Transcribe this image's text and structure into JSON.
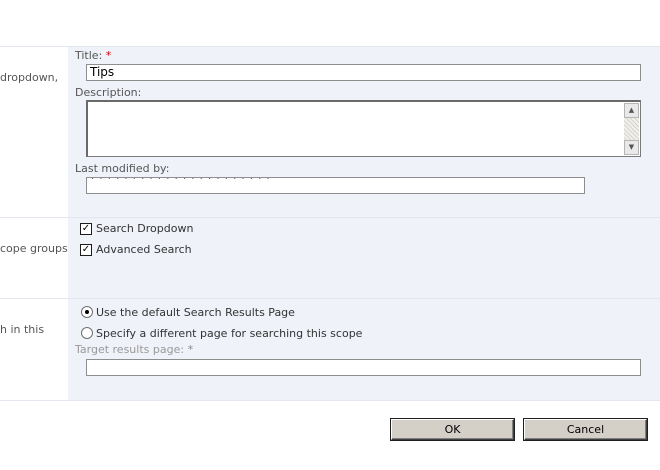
{
  "section_name": {
    "left_label": "dropdown,",
    "title_label": "Title:",
    "required_marker": "*",
    "title_value": "Tips",
    "description_label": "Description:",
    "description_value": "",
    "last_modified_label": "Last modified by:",
    "last_modified_value": "· · · · · · · · · · · · · · · · · · · · · ·"
  },
  "section_groups": {
    "left_label": "cope groups",
    "options": [
      {
        "label": "Search Dropdown",
        "checked": true
      },
      {
        "label": "Advanced Search",
        "checked": true
      }
    ]
  },
  "section_results": {
    "left_label": "h in this",
    "radio_default_label": "Use the default Search Results Page",
    "radio_specify_label": "Specify a different page for searching this scope",
    "target_label": "Target results page:",
    "target_required": "*",
    "target_value": ""
  },
  "buttons": {
    "ok": "OK",
    "cancel": "Cancel"
  }
}
